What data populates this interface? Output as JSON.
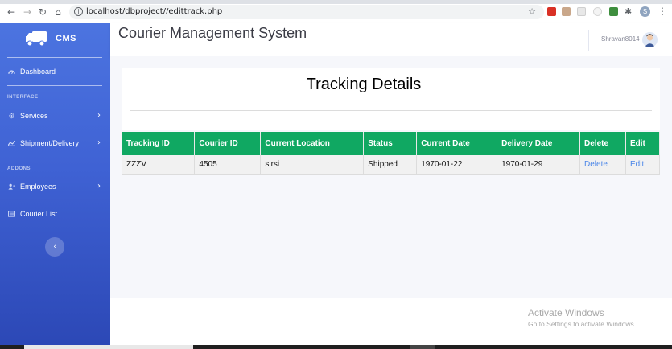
{
  "browser": {
    "url": "localhost/dbproject//edittrack.php",
    "profile_initial": "S"
  },
  "sidebar": {
    "brand": "CMS",
    "items": [
      {
        "label": "Dashboard",
        "icon": "tachometer-icon"
      },
      {
        "label": "Services",
        "icon": "gear-icon"
      },
      {
        "label": "Shipment/Delivery",
        "icon": "chart-icon"
      },
      {
        "label": "Employees",
        "icon": "user-plus-icon"
      },
      {
        "label": "Courier List",
        "icon": "list-icon"
      }
    ],
    "sections": [
      "INTERFACE",
      "ADDONS"
    ],
    "toggle_glyph": "‹"
  },
  "topbar": {
    "title": "Courier Management System",
    "username": "Shravan8014"
  },
  "content": {
    "heading": "Tracking Details",
    "columns": [
      "Tracking ID",
      "Courier ID",
      "Current Location",
      "Status",
      "Current Date",
      "Delivery Date",
      "Delete",
      "Edit"
    ],
    "rows": [
      [
        "ZZZV",
        "4505",
        "sirsi",
        "Shipped",
        "1970-01-22",
        "1970-01-29",
        "Delete",
        "Edit"
      ]
    ]
  },
  "watermark": {
    "line1": "Activate Windows",
    "line2": "Go to Settings to activate Windows."
  },
  "colors": {
    "sidebar_top": "#4c74e0",
    "sidebar_bottom": "#2c48b6",
    "table_header": "#10a862",
    "link": "#4a86e8"
  }
}
